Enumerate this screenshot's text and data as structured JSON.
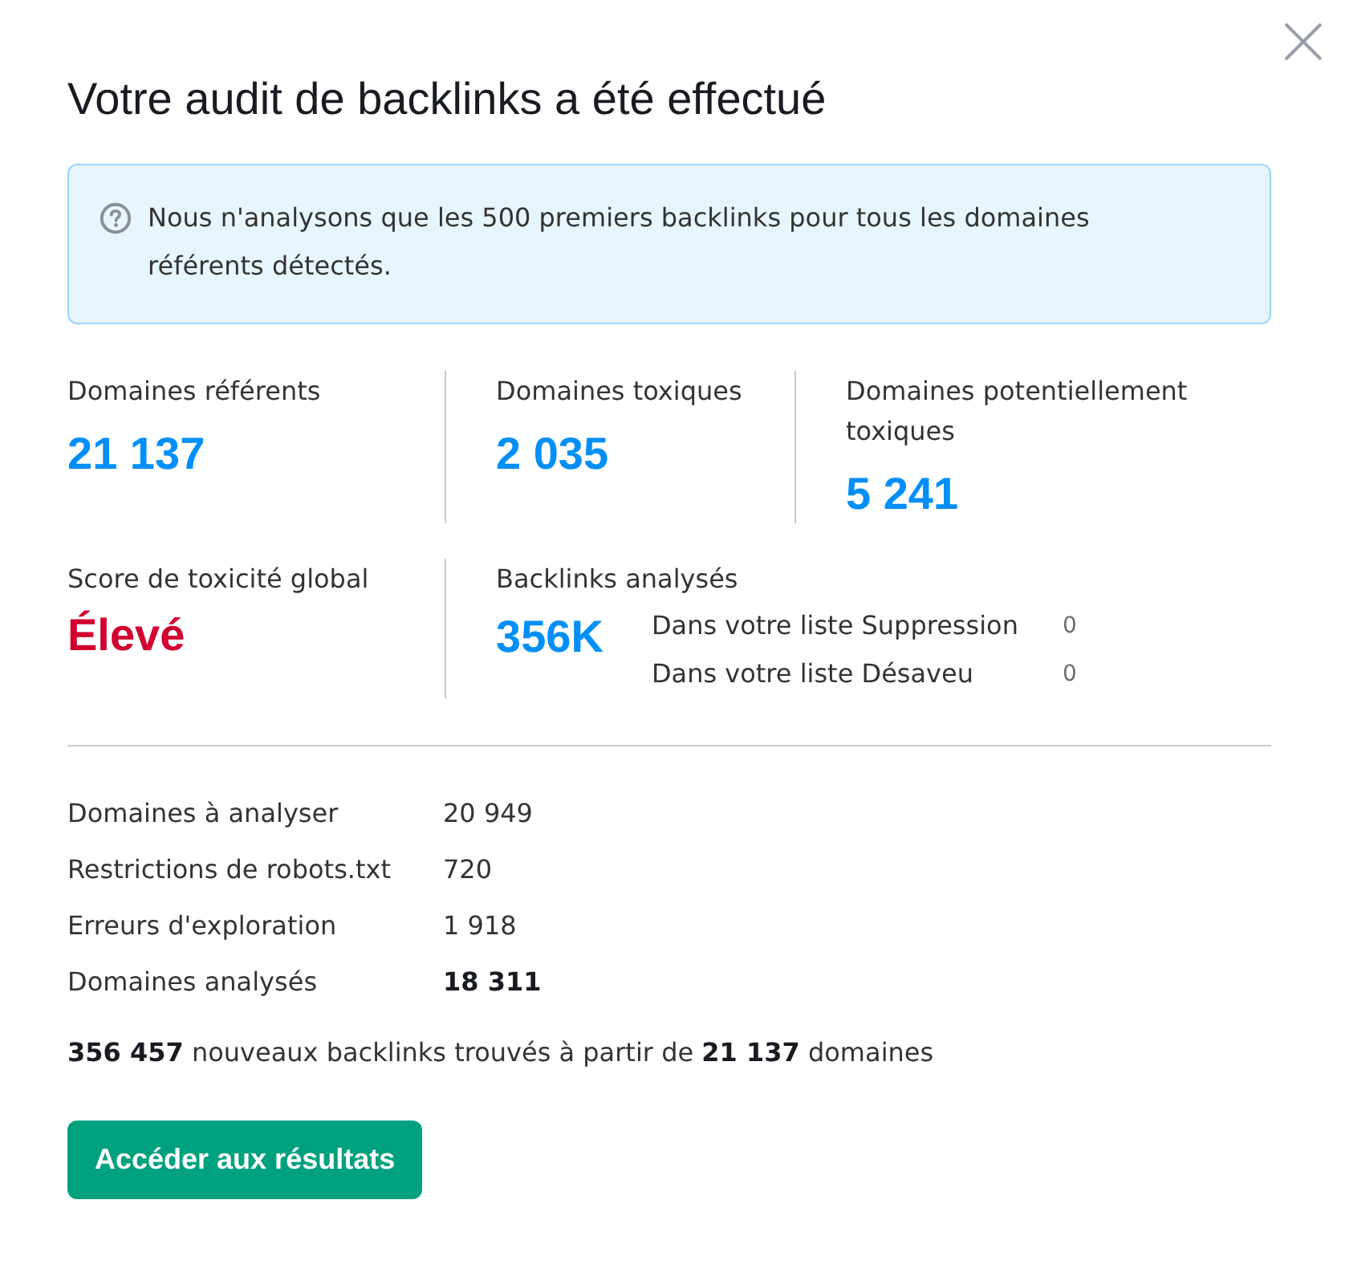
{
  "dialog": {
    "title": "Votre audit de backlinks a été effectué"
  },
  "notice": {
    "text": "Nous n'analysons que les 500 premiers backlinks pour tous les domaines référents détectés."
  },
  "summary_rows": [
    {
      "cells": [
        {
          "kind": "count",
          "label": "Domaines référents",
          "value": "21 137"
        },
        {
          "kind": "count",
          "label": "Domaines toxiques",
          "value": "2 035"
        },
        {
          "kind": "count",
          "label": "Domaines potentiellement toxiques",
          "value": "5 241"
        }
      ]
    },
    {
      "cells": [
        {
          "kind": "rating",
          "label": "Score de toxicité global",
          "value": "Élevé"
        },
        {
          "kind": "count",
          "label": "Backlinks analysés",
          "value": "356K",
          "lists": [
            {
              "label": "Dans votre liste Suppression",
              "value": "0"
            },
            {
              "label": "Dans votre liste Désaveu",
              "value": "0"
            }
          ]
        }
      ]
    }
  ],
  "details": [
    {
      "label": "Domaines à analyser",
      "value": "20 949",
      "total": false
    },
    {
      "label": "Restrictions de robots.txt",
      "value": "720",
      "total": false
    },
    {
      "label": "Erreurs d'exploration",
      "value": "1 918",
      "total": false
    },
    {
      "label": "Domaines analysés",
      "value": "18 311",
      "total": true
    }
  ],
  "result_text": "**356 457** nouveaux backlinks trouvés à partir de **21 137** domaines",
  "primary_button": {
    "label": "Accéder aux résultats"
  }
}
